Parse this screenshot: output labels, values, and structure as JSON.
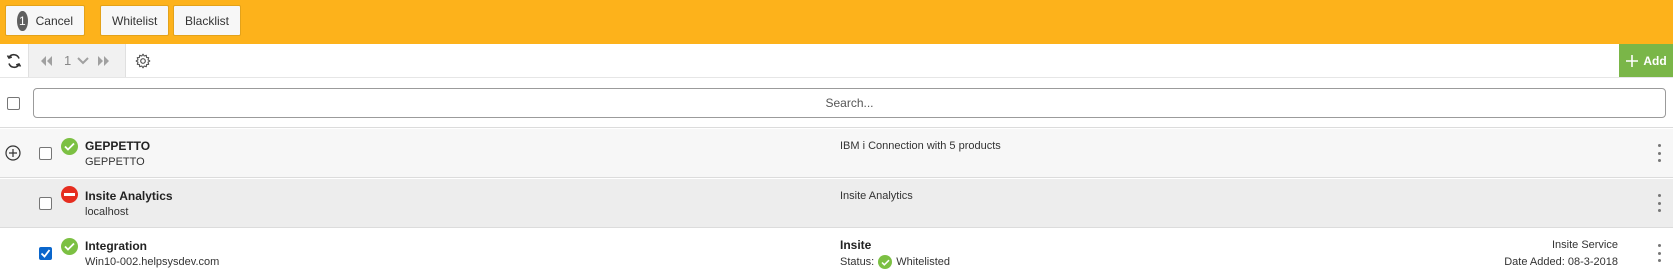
{
  "topbar": {
    "cancel": {
      "count": "1",
      "label": "Cancel"
    },
    "whitelist_label": "Whitelist",
    "blacklist_label": "Blacklist"
  },
  "toolbar": {
    "refresh_icon": "refresh-icon",
    "page_number": "1",
    "first_icon": "double-chevron-left-icon",
    "dropdown_icon": "chevron-down-icon",
    "last_icon": "double-chevron-right-icon",
    "settings_icon": "gear-icon",
    "add_label": "Add"
  },
  "search": {
    "placeholder": "Search..."
  },
  "rows": [
    {
      "name": "GEPPETTO",
      "host": "GEPPETTO",
      "status": "ok",
      "description": "IBM i Connection with 5 products",
      "checked": false,
      "expandable": true
    },
    {
      "name": "Insite Analytics",
      "host": "localhost",
      "status": "error",
      "description": "Insite Analytics",
      "checked": false,
      "expandable": false
    },
    {
      "name": "Integration",
      "host": "Win10-002.helpsysdev.com",
      "status": "ok",
      "description": "Insite",
      "status_label": "Status:",
      "status_value": "Whitelisted",
      "service": "Insite Service",
      "date_added": "Date Added: 08-3-2018",
      "checked": true,
      "expandable": false
    }
  ],
  "colors": {
    "topbar": "#fdb21b",
    "add_button": "#7ab648",
    "ok": "#7cc043",
    "error": "#e62d1f",
    "checkbox_checked": "#0a66cc"
  }
}
